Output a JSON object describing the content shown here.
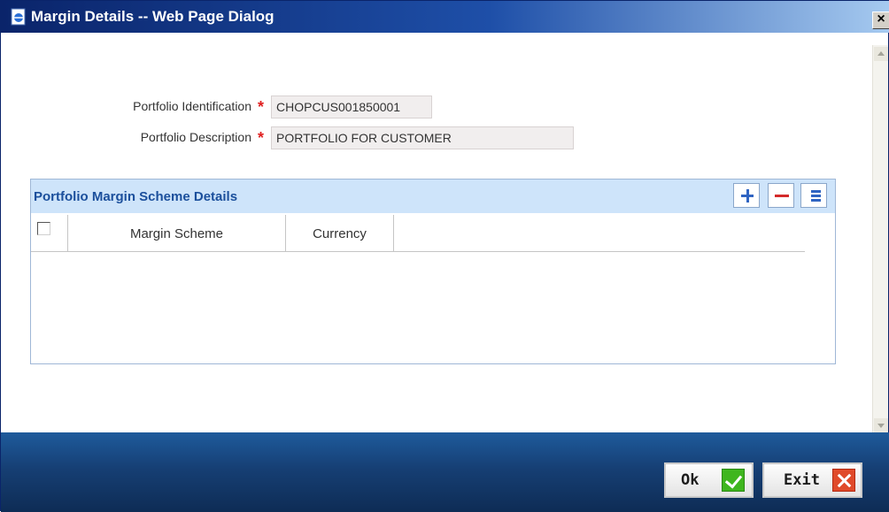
{
  "window": {
    "title": "Margin Details -- Web Page Dialog",
    "close_label": "×"
  },
  "form": {
    "portfolio_id_label": "Portfolio Identification",
    "portfolio_id_value": "CHOPCUS001850001",
    "portfolio_desc_label": "Portfolio Description",
    "portfolio_desc_value": "PORTFOLIO FOR CUSTOMER",
    "required_marker": "*"
  },
  "grid": {
    "title": "Portfolio Margin Scheme Details",
    "columns": [
      "Margin Scheme",
      "Currency"
    ],
    "rows": []
  },
  "footer": {
    "ok_label": "Ok",
    "exit_label": "Exit"
  },
  "colors": {
    "title_bar": "#0a246a",
    "panel_header": "#cee4fa",
    "panel_title": "#1b4f9c",
    "footer": "#163f74",
    "required": "#e02020"
  }
}
